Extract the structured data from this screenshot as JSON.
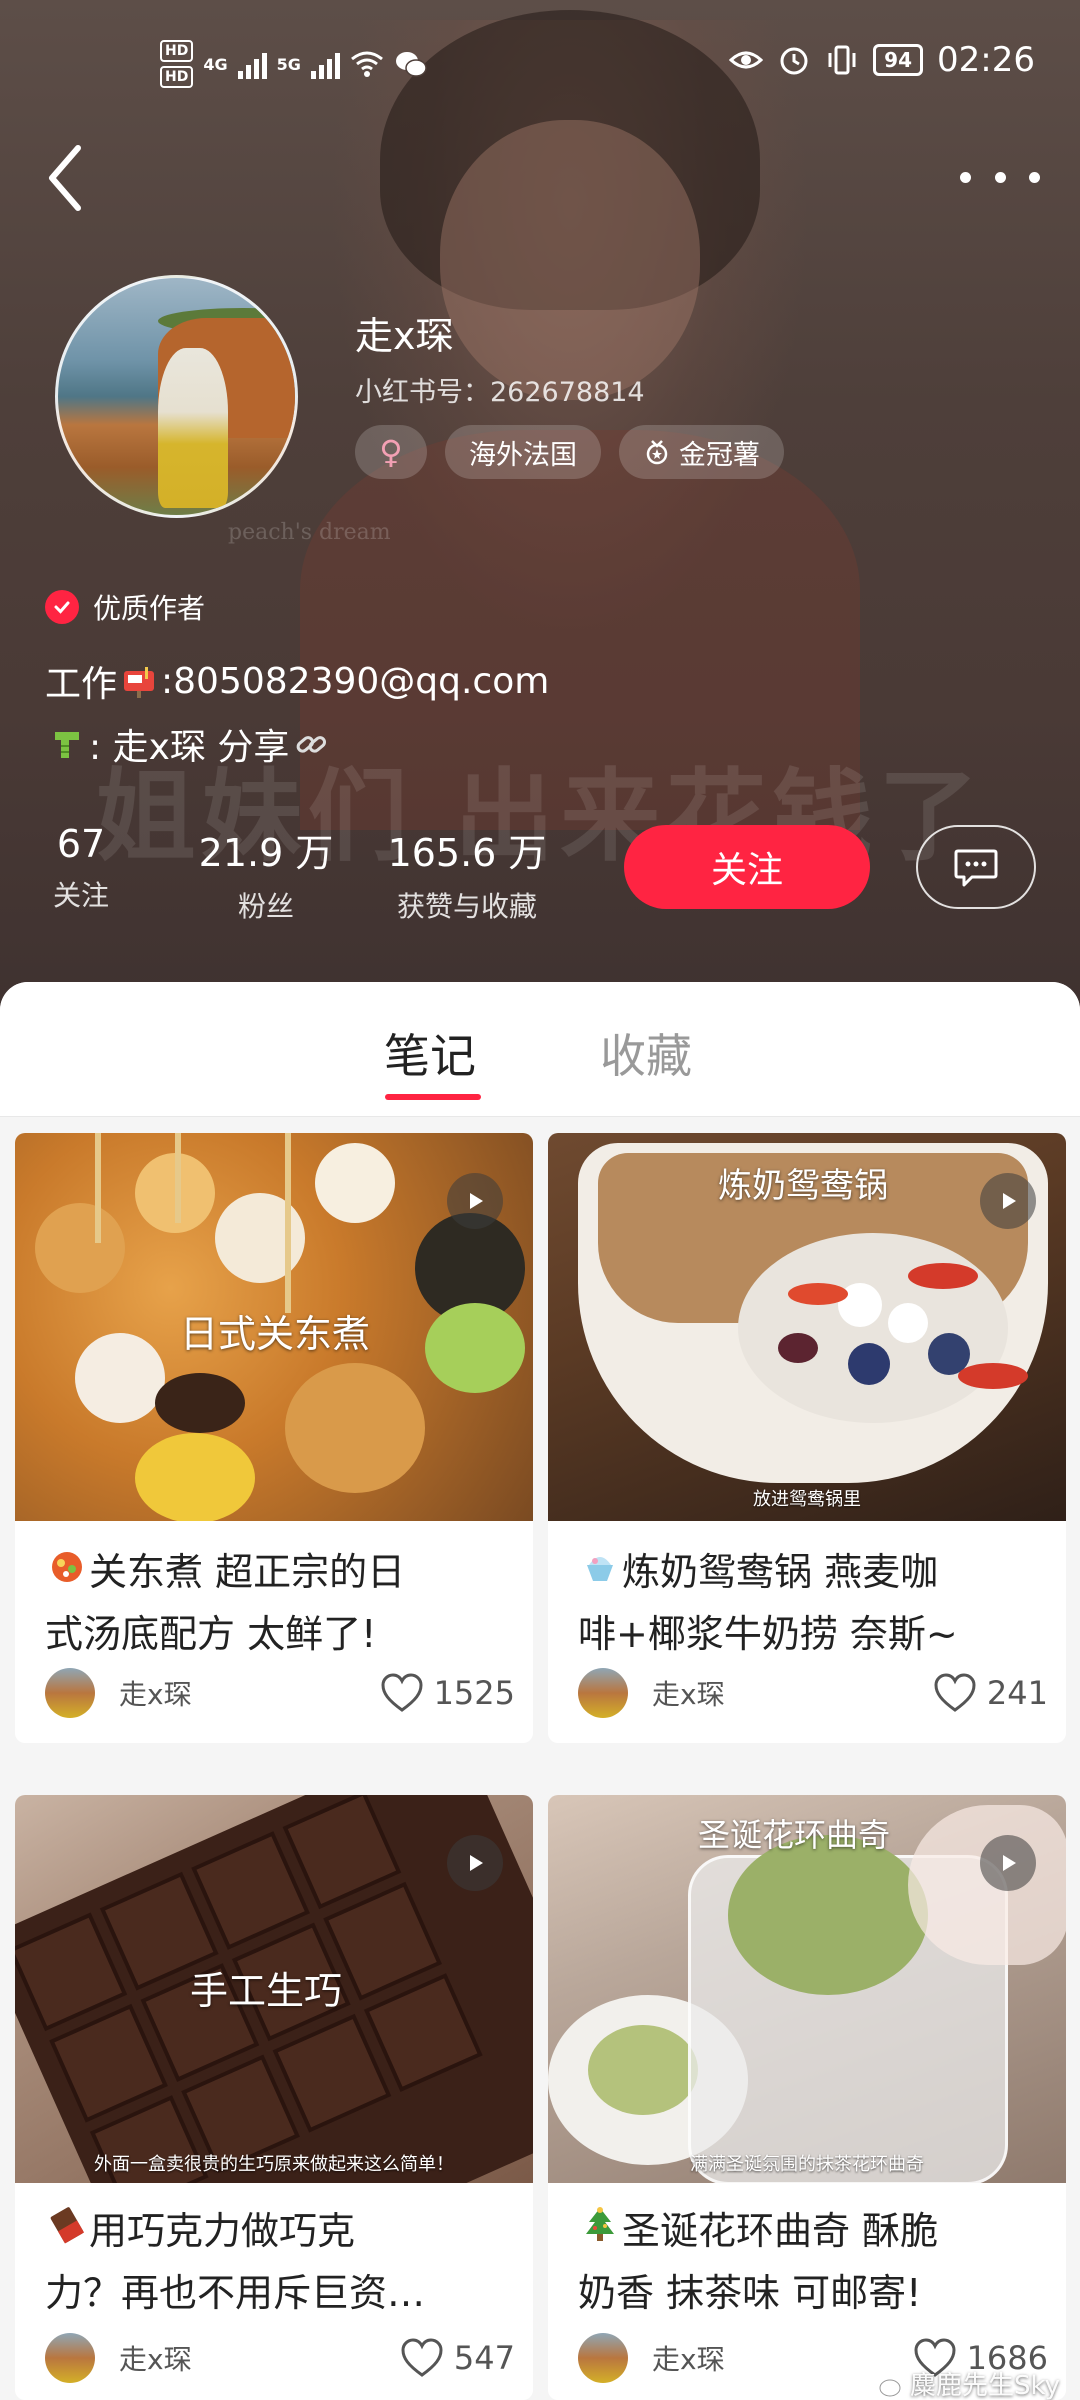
{
  "status_bar": {
    "hd_1": "HD",
    "hd_2": "HD",
    "net_1": "4G",
    "net_2": "5G",
    "battery": "94",
    "time": "02:26"
  },
  "profile": {
    "nickname": "走x琛",
    "red_id": "小红书号：262678814",
    "gender_symbol": "♀",
    "tags": [
      "海外法国",
      "金冠薯"
    ],
    "quality_badge": "优质作者",
    "bio_line1_prefix": "工作",
    "bio_line1_suffix": ":805082390@qq.com",
    "bio_line2_text": ": 走x琛 分享",
    "background_overlay_text": "姐妹们 出来花钱了",
    "background_watermark": "peach's dream"
  },
  "stats": [
    {
      "value": "67",
      "label": "关注"
    },
    {
      "value": "21.9 万",
      "label": "粉丝"
    },
    {
      "value": "165.6 万",
      "label": "获赞与收藏"
    }
  ],
  "actions": {
    "follow_label": "关注"
  },
  "tabs": {
    "notes": "笔记",
    "collections": "收藏"
  },
  "notes": [
    {
      "image_caption": "日式关东煮",
      "image_subcaption": "",
      "title_line1": "关东煮 超正宗的日",
      "title_line2": "式汤底配方 太鲜了!",
      "author": "走x琛",
      "likes": "1525",
      "title_icon": "hot-pot-emoji"
    },
    {
      "image_caption": "炼奶鸳鸯锅",
      "image_subcaption": "放进鸳鸯锅里",
      "title_line1": "炼奶鸳鸯锅 燕麦咖",
      "title_line2": "啡+椰浆牛奶捞 奈斯~",
      "author": "走x琛",
      "likes": "241",
      "title_icon": "shaved-ice-emoji"
    },
    {
      "image_caption": "手工生巧",
      "image_subcaption": "外面一盒卖很贵的生巧原来做起来这么简单！",
      "title_line1": "用巧克力做巧克",
      "title_line2": "力？再也不用斥巨资…",
      "author": "走x琛",
      "likes": "547",
      "title_icon": "chocolate-emoji"
    },
    {
      "image_caption": "圣诞花环曲奇",
      "image_subcaption": "满满圣诞氛围的抹茶花环曲奇",
      "title_line1": "圣诞花环曲奇 酥脆",
      "title_line2": "奶香 抹茶味 可邮寄!",
      "author": "走x琛",
      "likes": "1686",
      "title_icon": "christmas-tree-emoji"
    }
  ],
  "watermark": "麋鹿先生Sky",
  "colors": {
    "accent": "#ff2442",
    "header_bg": "#4e3f3a"
  }
}
